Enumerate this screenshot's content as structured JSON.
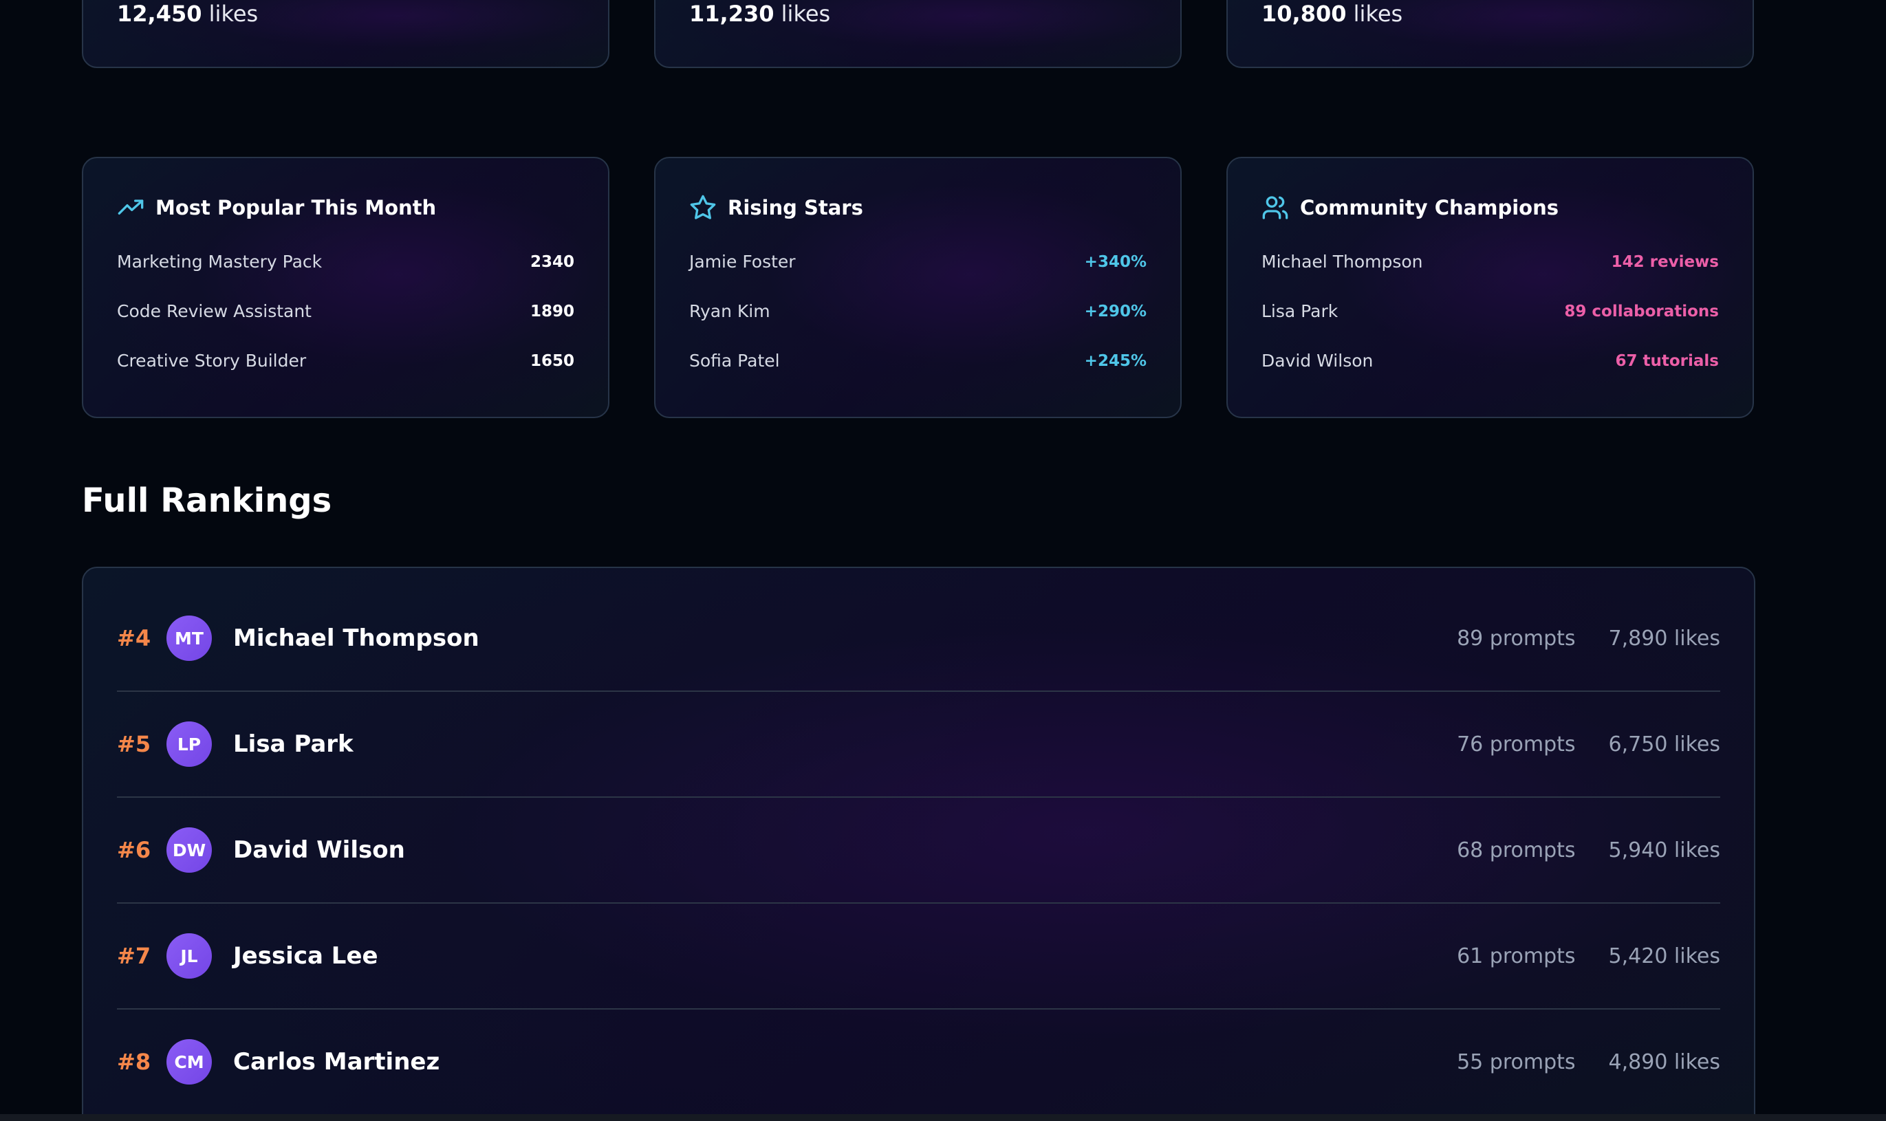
{
  "top_cards": [
    {
      "likes_value": "12,450",
      "likes_unit": "likes"
    },
    {
      "likes_value": "11,230",
      "likes_unit": "likes"
    },
    {
      "likes_value": "10,800",
      "likes_unit": "likes"
    }
  ],
  "stat_cards": {
    "popular": {
      "title": "Most Popular This Month",
      "icon": "trending-up-icon",
      "rows": [
        {
          "name": "Marketing Mastery Pack",
          "value": "2340"
        },
        {
          "name": "Code Review Assistant",
          "value": "1890"
        },
        {
          "name": "Creative Story Builder",
          "value": "1650"
        }
      ]
    },
    "rising": {
      "title": "Rising Stars",
      "icon": "star-icon",
      "rows": [
        {
          "name": "Jamie Foster",
          "value": "+340%"
        },
        {
          "name": "Ryan Kim",
          "value": "+290%"
        },
        {
          "name": "Sofia Patel",
          "value": "+245%"
        }
      ]
    },
    "champions": {
      "title": "Community Champions",
      "icon": "users-icon",
      "rows": [
        {
          "name": "Michael Thompson",
          "value": "142 reviews"
        },
        {
          "name": "Lisa Park",
          "value": "89 collaborations"
        },
        {
          "name": "David Wilson",
          "value": "67 tutorials"
        }
      ]
    }
  },
  "full_rankings": {
    "title": "Full Rankings",
    "rows": [
      {
        "rank": "#4",
        "initials": "MT",
        "name": "Michael Thompson",
        "prompts": "89 prompts",
        "likes": "7,890 likes"
      },
      {
        "rank": "#5",
        "initials": "LP",
        "name": "Lisa Park",
        "prompts": "76 prompts",
        "likes": "6,750 likes"
      },
      {
        "rank": "#6",
        "initials": "DW",
        "name": "David Wilson",
        "prompts": "68 prompts",
        "likes": "5,940 likes"
      },
      {
        "rank": "#7",
        "initials": "JL",
        "name": "Jessica Lee",
        "prompts": "61 prompts",
        "likes": "5,420 likes"
      },
      {
        "rank": "#8",
        "initials": "CM",
        "name": "Carlos Martinez",
        "prompts": "55 prompts",
        "likes": "4,890 likes"
      }
    ]
  },
  "colors": {
    "background": "#03070f",
    "rank_accent": "#f5874a",
    "growth_accent": "#4fc6e8",
    "champion_accent": "#ec5fa8",
    "avatar": "#8a5cf5",
    "icon_accent": "#4fc6e8"
  }
}
